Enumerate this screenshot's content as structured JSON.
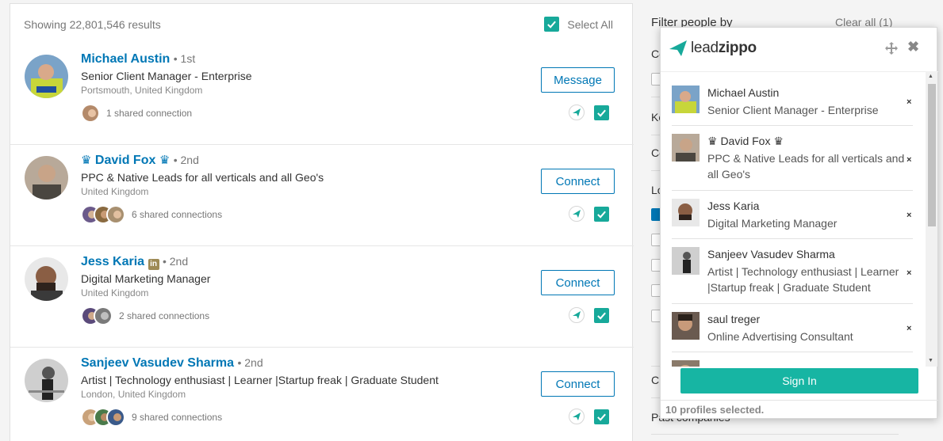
{
  "results": {
    "showing_text": "Showing 22,801,546 results",
    "select_all_label": "Select All",
    "items": [
      {
        "name": "Michael Austin",
        "degree": "• 1st",
        "headline": "Senior Client Manager - Enterprise",
        "location": "Portsmouth, United Kingdom",
        "shared_connections": "1 shared connection",
        "action_label": "Message",
        "avatar_color": "#c7d63a",
        "selected": true
      },
      {
        "name": "David Fox",
        "name_prefix": "♛",
        "name_suffix": "♛",
        "degree": "• 2nd",
        "headline": "PPC & Native Leads for all verticals and all Geo's",
        "location": "United Kingdom",
        "shared_connections": "6 shared connections",
        "action_label": "Connect",
        "avatar_color": "#8c7a6b",
        "selected": true
      },
      {
        "name": "Jess Karia",
        "badge": "in",
        "degree": "• 2nd",
        "headline": "Digital Marketing Manager",
        "location": "United Kingdom",
        "shared_connections": "2 shared connections",
        "action_label": "Connect",
        "avatar_color": "#7a5b48",
        "selected": true
      },
      {
        "name": "Sanjeev Vasudev Sharma",
        "degree": "• 2nd",
        "headline": "Artist | Technology enthusiast | Learner |Startup freak | Graduate Student",
        "location": "London, United Kingdom",
        "shared_connections": "9 shared connections",
        "action_label": "Connect",
        "avatar_color": "#9a9a9a",
        "selected": true
      }
    ]
  },
  "filters": {
    "title": "Filter people by",
    "clear_all": "Clear all (1)",
    "partial_labels": [
      "Co",
      "Ke",
      "Co",
      "Lo",
      "Cu",
      "Past companies"
    ]
  },
  "leadzippo": {
    "logo_lead": "lead",
    "logo_zippo": "zippo",
    "profiles": [
      {
        "name": "Michael Austin",
        "desc": "Senior Client Manager - Enterprise",
        "thumb_color": "#c7d63a"
      },
      {
        "name": "♛ David Fox ♛",
        "desc": "PPC & Native Leads for all verticals and all Geo's",
        "thumb_color": "#8c7a6b"
      },
      {
        "name": "Jess Karia",
        "desc": "Digital Marketing Manager",
        "thumb_color": "#7a5b48"
      },
      {
        "name": "Sanjeev Vasudev Sharma",
        "desc": "Artist | Technology enthusiast | Learner |Startup freak | Graduate Student",
        "thumb_color": "#9a9a9a"
      },
      {
        "name": "saul treger",
        "desc": "Online Advertising Consultant",
        "thumb_color": "#5a4a40"
      }
    ],
    "remove_symbol": "×",
    "sign_in_label": "Sign In",
    "selected_count": "10 profiles selected."
  },
  "colors": {
    "linkedin_blue": "#0077b5",
    "teal": "#17a99a",
    "signin_teal": "#17b5a3"
  }
}
